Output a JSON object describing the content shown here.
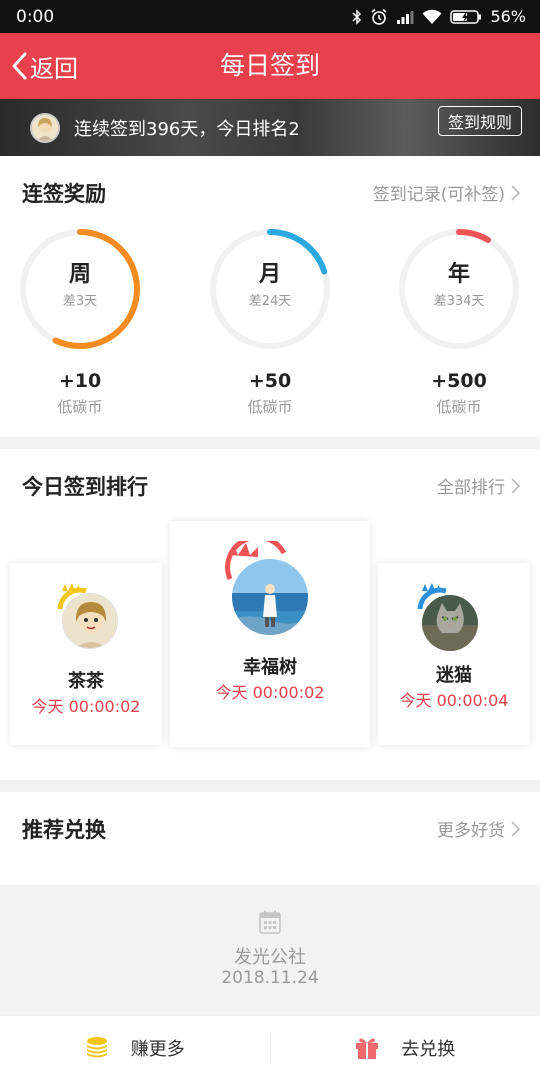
{
  "status_bar": {
    "time": "0:00",
    "battery": "56%",
    "icons": [
      "bluetooth-icon",
      "alarm-icon",
      "signal-icon",
      "wifi-icon",
      "battery-charging-icon"
    ]
  },
  "nav": {
    "back_label": "返回",
    "title": "每日签到",
    "back_icon": "chevron-left-icon",
    "bar_color": "#e8414b"
  },
  "banner": {
    "text": "连续签到396天，今日排名2",
    "rules_label": "签到规则"
  },
  "rewards": {
    "title": "连签奖励",
    "link_label": "签到记录(可补签)",
    "items": [
      {
        "period": "周",
        "remaining": "差3天",
        "amount": "+10",
        "unit": "低碳币",
        "progress": 0.57,
        "color": "#f68b1f"
      },
      {
        "period": "月",
        "remaining": "差24天",
        "amount": "+50",
        "unit": "低碳币",
        "progress": 0.2,
        "color": "#2ba8e0"
      },
      {
        "period": "年",
        "remaining": "差334天",
        "amount": "+500",
        "unit": "低碳币",
        "progress": 0.085,
        "color": "#ef5454"
      }
    ]
  },
  "ranking": {
    "title": "今日签到排行",
    "link_label": "全部排行",
    "entries": [
      {
        "name": "茶茶",
        "time": "今天 00:00:02",
        "crown_color": "#f5c518"
      },
      {
        "name": "幸福树",
        "time": "今天 00:00:02",
        "crown_color": "#ef5454"
      },
      {
        "name": "迷猫",
        "time": "今天 00:00:04",
        "crown_color": "#2b8fd9"
      }
    ]
  },
  "exchange": {
    "title": "推荐兑换",
    "link_label": "更多好货",
    "item_name": "发光公社",
    "item_date": "2018.11.24"
  },
  "bottom_bar": {
    "earn_label": "赚更多",
    "redeem_label": "去兑换"
  }
}
